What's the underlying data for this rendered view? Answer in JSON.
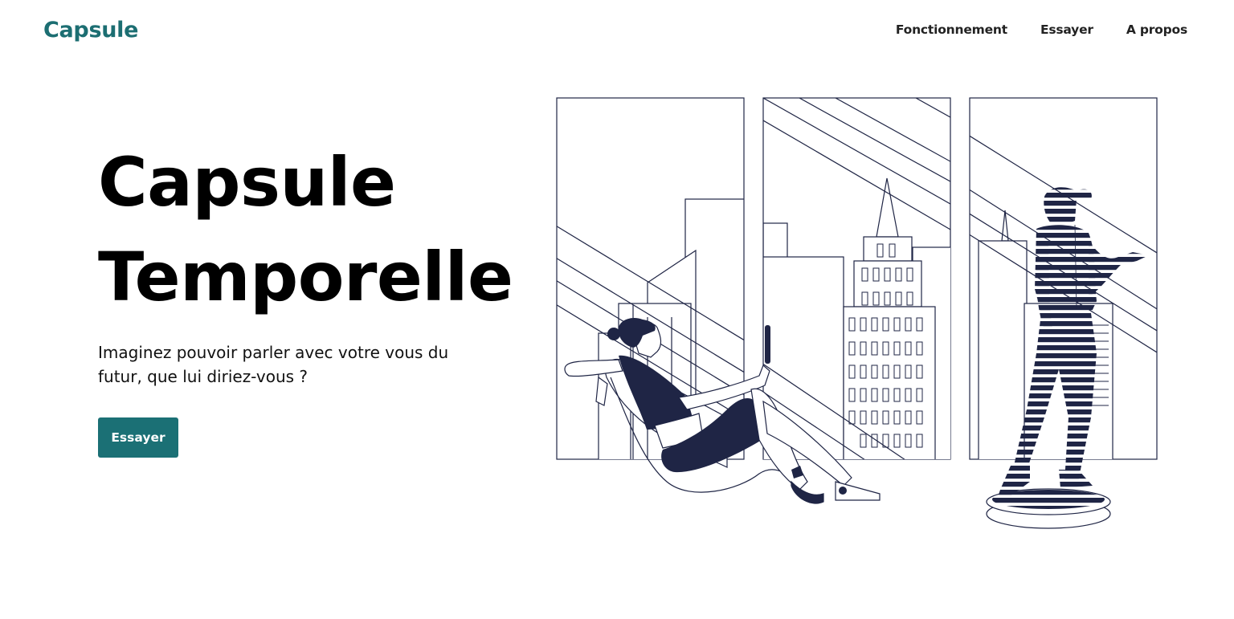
{
  "header": {
    "brand": "Capsule",
    "nav": [
      "Fonctionnement",
      "Essayer",
      "A propos"
    ]
  },
  "hero": {
    "title_line1": "Capsule",
    "title_line2": "Temporelle",
    "subtitle": "Imaginez pouvoir parler avec votre vous du futur, que lui diriez-vous ?",
    "cta_label": "Essayer"
  },
  "colors": {
    "brand": "#1c6e72",
    "button": "#1b7075",
    "illustration_fill": "#1f2545"
  }
}
